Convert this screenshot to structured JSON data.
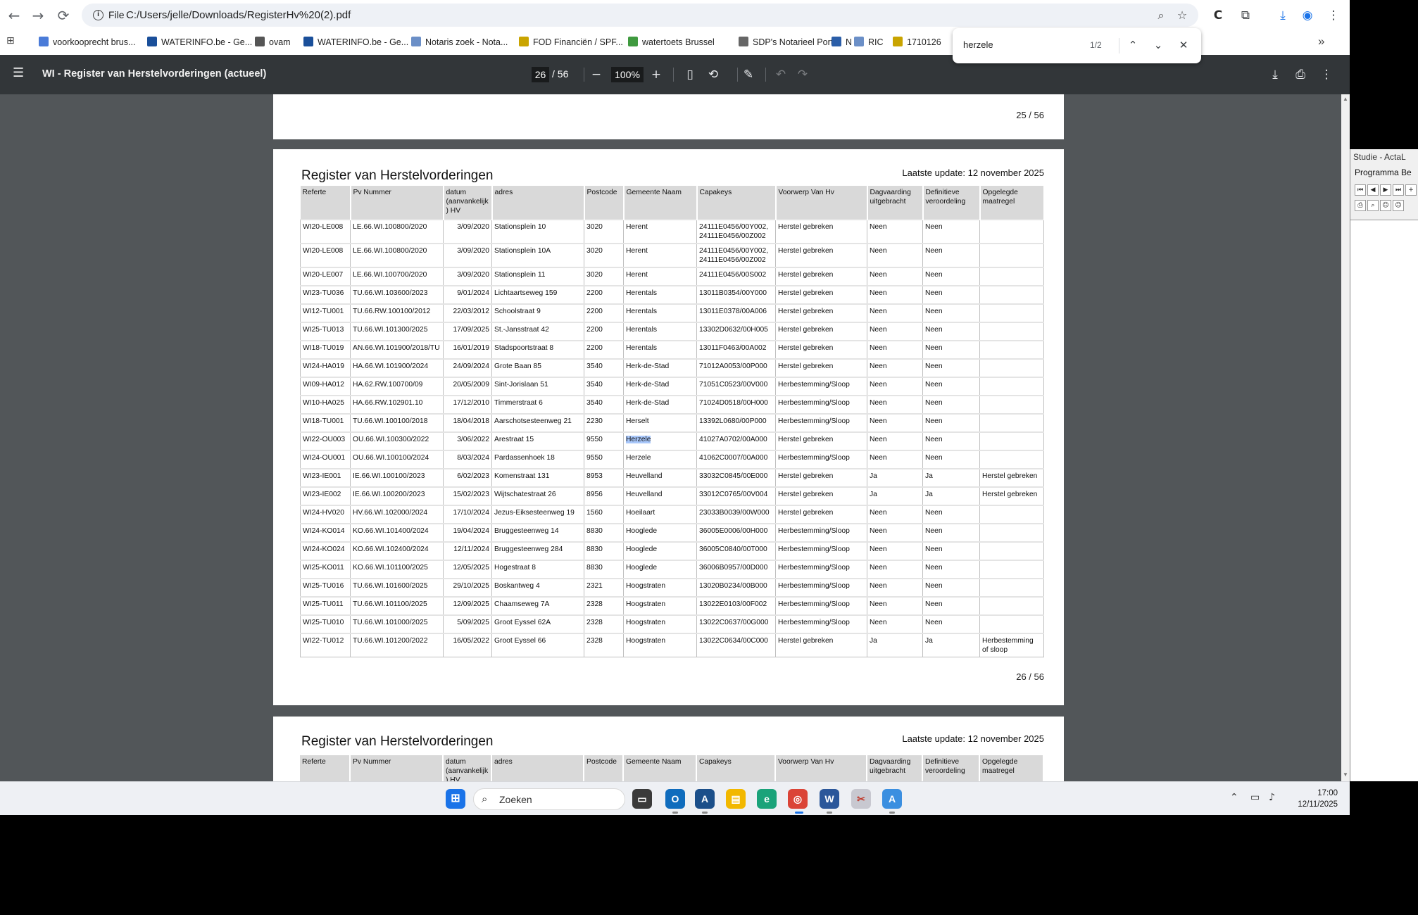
{
  "browser": {
    "nav": {
      "back": "←",
      "forward": "→",
      "reload": "⟳"
    },
    "omnibox": {
      "chip_label": "File",
      "url": "C:/Users/jelle/Downloads/RegisterHv%20(2).pdf"
    },
    "bookmarks": [
      {
        "label": "voorkooprecht brus...",
        "icon": "voorkooprecht-icon",
        "color": "#4a7bd8"
      },
      {
        "label": "WATERINFO.be - Ge...",
        "icon": "waterinfo-icon",
        "color": "#1a4f9a"
      },
      {
        "label": "ovam",
        "icon": "ovam-icon",
        "color": "#555555"
      },
      {
        "label": "WATERINFO.be - Ge...",
        "icon": "waterinfo-icon",
        "color": "#1a4f9a"
      },
      {
        "label": "Notaris zoek - Nota...",
        "icon": "notaris-icon",
        "color": "#6b8fc7"
      },
      {
        "label": "FOD Financiën / SPF...",
        "icon": "fod-icon",
        "color": "#c9a400"
      },
      {
        "label": "watertoets Brussel",
        "icon": "watertoets-icon",
        "color": "#3f9a3f"
      },
      {
        "label": "SDP's Notarieel Port...",
        "icon": "sdp-icon",
        "color": "#666666"
      },
      {
        "label": "N",
        "icon": "n-icon",
        "color": "#2b5ea8"
      },
      {
        "label": "RIC",
        "icon": "ric-icon",
        "color": "#6b8fc7"
      },
      {
        "label": "1710126",
        "icon": "be-icon",
        "color": "#c9a400"
      }
    ],
    "bookmarks_overflow": "»"
  },
  "findbar": {
    "query": "herzele",
    "count": "1/2"
  },
  "pdf": {
    "title": "WI - Register van Herstelvorderingen (actueel)",
    "current_page": "26",
    "total_pages": "/ 56",
    "zoom": "100%",
    "prev_page_number": "25 / 56",
    "doc_title": "Register van Herstelvorderingen",
    "last_update": "Laatste update: 12 november 2025",
    "page_number": "26 / 56",
    "columns": [
      "Referte",
      "Pv Nummer",
      "datum (aanvankelijk ) HV",
      "adres",
      "Postcode",
      "Gemeente Naam",
      "Capakeys",
      "Voorwerp Van Hv",
      "Dagvaarding uitgebracht",
      "Definitieve veroordeling",
      "Opgelegde maatregel"
    ],
    "rows": [
      [
        "WI20-LE008",
        "LE.66.WI.100800/2020",
        "3/09/2020",
        "Stationsplein 10",
        "3020",
        "Herent",
        "24111E0456/00Y002, 24111E0456/00Z002",
        "Herstel gebreken",
        "Neen",
        "Neen",
        ""
      ],
      [
        "WI20-LE008",
        "LE.66.WI.100800/2020",
        "3/09/2020",
        "Stationsplein 10A",
        "3020",
        "Herent",
        "24111E0456/00Y002, 24111E0456/00Z002",
        "Herstel gebreken",
        "Neen",
        "Neen",
        ""
      ],
      [
        "WI20-LE007",
        "LE.66.WI.100700/2020",
        "3/09/2020",
        "Stationsplein 11",
        "3020",
        "Herent",
        "24111E0456/00S002",
        "Herstel gebreken",
        "Neen",
        "Neen",
        ""
      ],
      [
        "WI23-TU036",
        "TU.66.WI.103600/2023",
        "9/01/2024",
        "Lichtaartseweg 159",
        "2200",
        "Herentals",
        "13011B0354/00Y000",
        "Herstel gebreken",
        "Neen",
        "Neen",
        ""
      ],
      [
        "WI12-TU001",
        "TU.66.RW.100100/2012",
        "22/03/2012",
        "Schoolstraat 9",
        "2200",
        "Herentals",
        "13011E0378/00A006",
        "Herstel gebreken",
        "Neen",
        "Neen",
        ""
      ],
      [
        "WI25-TU013",
        "TU.66.WI.101300/2025",
        "17/09/2025",
        "St.-Jansstraat 42",
        "2200",
        "Herentals",
        "13302D0632/00H005",
        "Herstel gebreken",
        "Neen",
        "Neen",
        ""
      ],
      [
        "WI18-TU019",
        "AN.66.WI.101900/2018/TU",
        "16/01/2019",
        "Stadspoortstraat 8",
        "2200",
        "Herentals",
        "13011F0463/00A002",
        "Herstel gebreken",
        "Neen",
        "Neen",
        ""
      ],
      [
        "WI24-HA019",
        "HA.66.WI.101900/2024",
        "24/09/2024",
        "Grote Baan 85",
        "3540",
        "Herk-de-Stad",
        "71012A0053/00P000",
        "Herstel gebreken",
        "Neen",
        "Neen",
        ""
      ],
      [
        "WI09-HA012",
        "HA.62.RW.100700/09",
        "20/05/2009",
        "Sint-Jorislaan 51",
        "3540",
        "Herk-de-Stad",
        "71051C0523/00V000",
        "Herbestemming/Sloop",
        "Neen",
        "Neen",
        ""
      ],
      [
        "WI10-HA025",
        "HA.66.RW.102901.10",
        "17/12/2010",
        "Timmerstraat 6",
        "3540",
        "Herk-de-Stad",
        "71024D0518/00H000",
        "Herbestemming/Sloop",
        "Neen",
        "Neen",
        ""
      ],
      [
        "WI18-TU001",
        "TU.66.WI.100100/2018",
        "18/04/2018",
        "Aarschotsesteenweg 21",
        "2230",
        "Herselt",
        "13392L0680/00P000",
        "Herbestemming/Sloop",
        "Neen",
        "Neen",
        ""
      ],
      [
        "WI22-OU003",
        "OU.66.WI.100300/2022",
        "3/06/2022",
        "Arestraat 15",
        "9550",
        "Herzele",
        "41027A0702/00A000",
        "Herstel gebreken",
        "Neen",
        "Neen",
        ""
      ],
      [
        "WI24-OU001",
        "OU.66.WI.100100/2024",
        "8/03/2024",
        "Pardassenhoek 18",
        "9550",
        "Herzele",
        "41062C0007/00A000",
        "Herbestemming/Sloop",
        "Neen",
        "Neen",
        ""
      ],
      [
        "WI23-IE001",
        "IE.66.WI.100100/2023",
        "6/02/2023",
        "Komenstraat 131",
        "8953",
        "Heuvelland",
        "33032C0845/00E000",
        "Herstel gebreken",
        "Ja",
        "Ja",
        "Herstel gebreken"
      ],
      [
        "WI23-IE002",
        "IE.66.WI.100200/2023",
        "15/02/2023",
        "Wijtschatestraat 26",
        "8956",
        "Heuvelland",
        "33012C0765/00V004",
        "Herstel gebreken",
        "Ja",
        "Ja",
        "Herstel gebreken"
      ],
      [
        "WI24-HV020",
        "HV.66.WI.102000/2024",
        "17/10/2024",
        "Jezus-Eiksesteenweg 19",
        "1560",
        "Hoeilaart",
        "23033B0039/00W000",
        "Herstel gebreken",
        "Neen",
        "Neen",
        ""
      ],
      [
        "WI24-KO014",
        "KO.66.WI.101400/2024",
        "19/04/2024",
        "Bruggesteenweg 14",
        "8830",
        "Hooglede",
        "36005E0006/00H000",
        "Herbestemming/Sloop",
        "Neen",
        "Neen",
        ""
      ],
      [
        "WI24-KO024",
        "KO.66.WI.102400/2024",
        "12/11/2024",
        "Bruggesteenweg 284",
        "8830",
        "Hooglede",
        "36005C0840/00T000",
        "Herbestemming/Sloop",
        "Neen",
        "Neen",
        ""
      ],
      [
        "WI25-KO011",
        "KO.66.WI.101100/2025",
        "12/05/2025",
        "Hogestraat 8",
        "8830",
        "Hooglede",
        "36006B0957/00D000",
        "Herbestemming/Sloop",
        "Neen",
        "Neen",
        ""
      ],
      [
        "WI25-TU016",
        "TU.66.WI.101600/2025",
        "29/10/2025",
        "Boskantweg 4",
        "2321",
        "Hoogstraten",
        "13020B0234/00B000",
        "Herbestemming/Sloop",
        "Neen",
        "Neen",
        ""
      ],
      [
        "WI25-TU011",
        "TU.66.WI.101100/2025",
        "12/09/2025",
        "Chaamseweg 7A",
        "2328",
        "Hoogstraten",
        "13022E0103/00F002",
        "Herbestemming/Sloop",
        "Neen",
        "Neen",
        ""
      ],
      [
        "WI25-TU010",
        "TU.66.WI.101000/2025",
        "5/09/2025",
        "Groot Eyssel 62A",
        "2328",
        "Hoogstraten",
        "13022C0637/00G000",
        "Herbestemming/Sloop",
        "Neen",
        "Neen",
        ""
      ],
      [
        "WI22-TU012",
        "TU.66.WI.101200/2022",
        "16/05/2022",
        "Groot Eyssel 66",
        "2328",
        "Hoogstraten",
        "13022C0634/00C000",
        "Herstel gebreken",
        "Ja",
        "Ja",
        "Herbestemming of sloop"
      ]
    ]
  },
  "side_app": {
    "title": "Studie - ActaL",
    "menu": "Programma  Be",
    "tools": [
      "⏮",
      "◀",
      "▶",
      "⏭",
      "+"
    ]
  },
  "taskbar": {
    "search_label": "Zoeken",
    "time": "17:00",
    "date": "12/11/2025"
  }
}
